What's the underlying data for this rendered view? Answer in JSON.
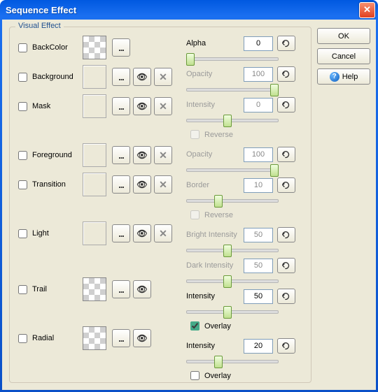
{
  "window": {
    "title": "Sequence Effect",
    "group_label": "Visual Effect"
  },
  "buttons": {
    "ok": "OK",
    "cancel": "Cancel",
    "help": "Help"
  },
  "effects": {
    "backcolor": {
      "label": "BackColor"
    },
    "background": {
      "label": "Background"
    },
    "mask": {
      "label": "Mask"
    },
    "foreground": {
      "label": "Foreground"
    },
    "transition": {
      "label": "Transition"
    },
    "light": {
      "label": "Light"
    },
    "trail": {
      "label": "Trail"
    },
    "radial": {
      "label": "Radial"
    }
  },
  "params": {
    "alpha": {
      "label": "Alpha",
      "value": "0",
      "pos_pct": 0
    },
    "bg_opacity": {
      "label": "Opacity",
      "value": "100",
      "pos_pct": 100
    },
    "mask_intensity": {
      "label": "Intensity",
      "value": "0",
      "pos_pct": 40
    },
    "mask_reverse": {
      "label": "Reverse",
      "checked": false
    },
    "fg_opacity": {
      "label": "Opacity",
      "value": "100",
      "pos_pct": 100
    },
    "border": {
      "label": "Border",
      "value": "10",
      "pos_pct": 30
    },
    "tr_reverse": {
      "label": "Reverse",
      "checked": false
    },
    "bright": {
      "label": "Bright Intensity",
      "value": "50",
      "pos_pct": 40
    },
    "dark": {
      "label": "Dark Intensity",
      "value": "50",
      "pos_pct": 40
    },
    "trail_intensity": {
      "label": "Intensity",
      "value": "50",
      "pos_pct": 40
    },
    "trail_overlay": {
      "label": "Overlay",
      "checked": true
    },
    "radial_intensity": {
      "label": "Intensity",
      "value": "20",
      "pos_pct": 30
    },
    "radial_overlay": {
      "label": "Overlay",
      "checked": false
    }
  }
}
